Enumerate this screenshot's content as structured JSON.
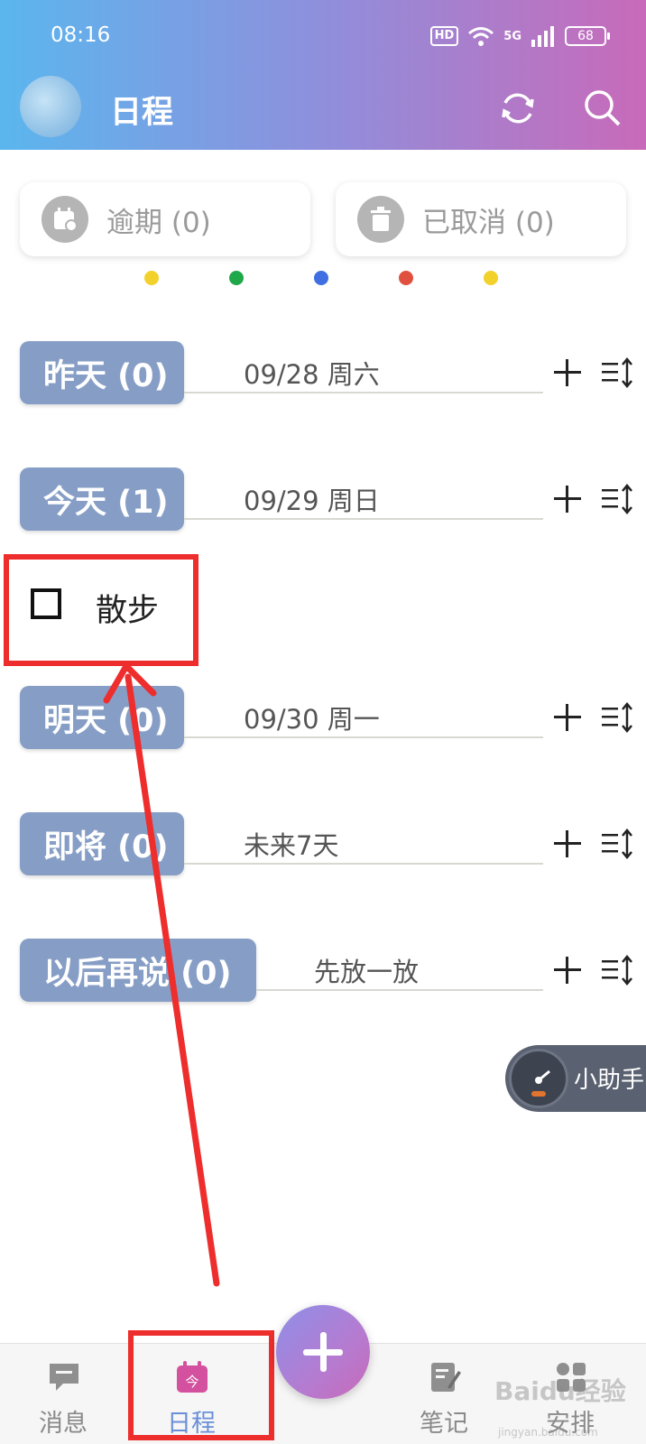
{
  "status_bar": {
    "time": "08:16",
    "hd": "HD",
    "network": "5G",
    "battery": "68"
  },
  "header": {
    "title": "日程",
    "sync_icon": "sync-icon",
    "search_icon": "search-icon"
  },
  "filters": [
    {
      "label": "逾期 (0)",
      "icon": "calendar-clock-icon"
    },
    {
      "label": "已取消 (0)",
      "icon": "trash-icon"
    }
  ],
  "color_dots": [
    "#f2d12a",
    "#1fa84a",
    "#3f6fe0",
    "#e0503f",
    "#f2d12a"
  ],
  "sections": [
    {
      "label": "昨天 (0)",
      "date": "09/28 周六"
    },
    {
      "label": "今天 (1)",
      "date": "09/29 周日"
    },
    {
      "label": "明天 (0)",
      "date": "09/30 周一"
    },
    {
      "label": "即将 (0)",
      "date": "未来7天"
    },
    {
      "label": "以后再说 (0)",
      "date": "先放一放"
    }
  ],
  "task": {
    "label": "散步",
    "checked": false
  },
  "assistant": {
    "label": "小助手"
  },
  "nav": [
    {
      "label": "消息",
      "icon": "message-icon",
      "active": false
    },
    {
      "label": "日程",
      "icon": "calendar-today-icon",
      "active": true,
      "icon_text": "今"
    },
    {
      "label": "笔记",
      "icon": "note-icon",
      "active": false
    },
    {
      "label": "安排",
      "icon": "grid-icon",
      "active": false
    }
  ],
  "watermark": {
    "brand": "Baidu经验",
    "url": "jingyan.baidu.com"
  },
  "colors": {
    "accent": "#869ec6",
    "highlight": "#ee2d2d",
    "active_nav": "#6a8fd9"
  }
}
